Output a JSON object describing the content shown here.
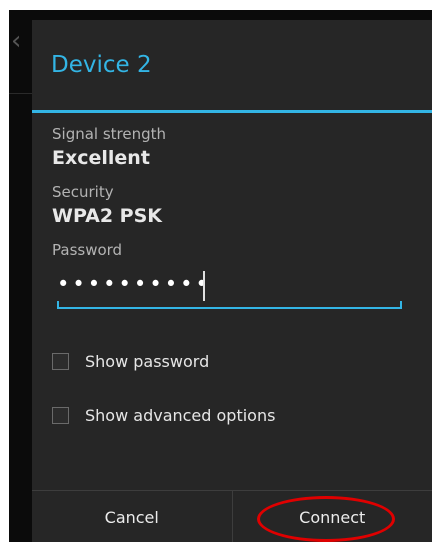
{
  "background": {
    "back_glyph": "‹"
  },
  "dialog": {
    "title": "Device 2",
    "signal": {
      "label": "Signal strength",
      "value": "Excellent"
    },
    "security": {
      "label": "Security",
      "value": "WPA2 PSK"
    },
    "password": {
      "label": "Password",
      "value": "••••••••••"
    },
    "options": {
      "show_password": "Show password",
      "show_advanced": "Show advanced options"
    },
    "buttons": {
      "cancel": "Cancel",
      "connect": "Connect"
    }
  },
  "colors": {
    "accent": "#33b5e5",
    "highlight_ring": "#e00000",
    "dialog_bg": "#262626"
  }
}
